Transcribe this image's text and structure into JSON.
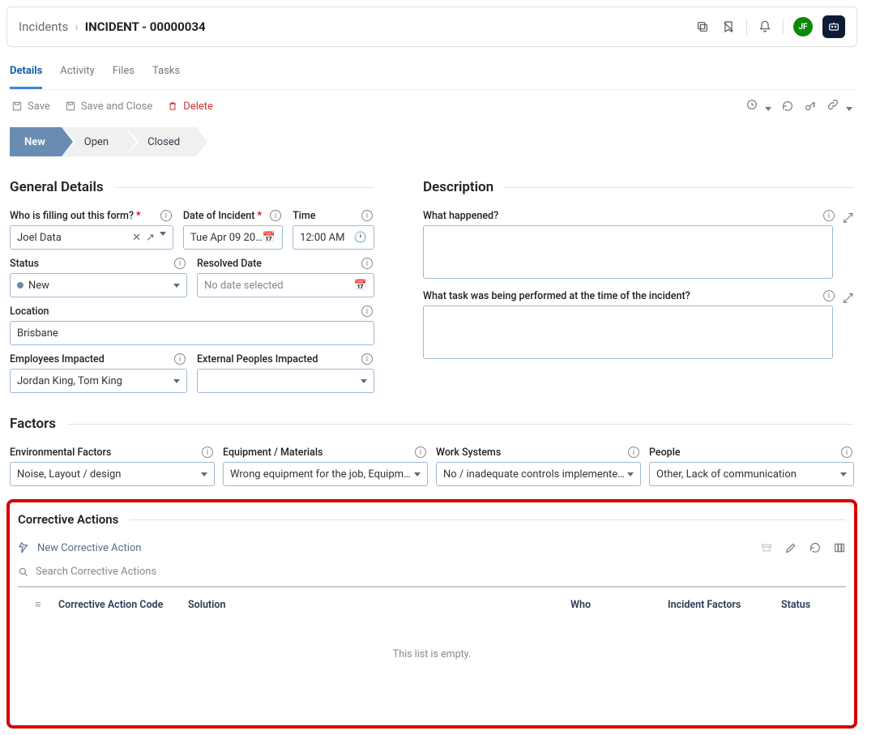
{
  "breadcrumb": {
    "root": "Incidents",
    "title": "INCIDENT - 00000034"
  },
  "header": {
    "avatar": "JF"
  },
  "tabs": [
    {
      "label": "Details",
      "active": true
    },
    {
      "label": "Activity"
    },
    {
      "label": "Files"
    },
    {
      "label": "Tasks"
    }
  ],
  "toolbar": {
    "save": "Save",
    "save_close": "Save and Close",
    "delete": "Delete"
  },
  "stages": [
    {
      "label": "New",
      "active": true
    },
    {
      "label": "Open"
    },
    {
      "label": "Closed"
    }
  ],
  "sections": {
    "general": {
      "title": "General Details",
      "filler": {
        "label": "Who is filling out this form?",
        "required": true,
        "value": "Joel Data"
      },
      "date": {
        "label": "Date of Incident",
        "required": true,
        "value": "Tue Apr 09 20…"
      },
      "time": {
        "label": "Time",
        "value": "12:00 AM"
      },
      "status": {
        "label": "Status",
        "value": "New"
      },
      "resolved": {
        "label": "Resolved Date",
        "placeholder": "No date selected"
      },
      "location": {
        "label": "Location",
        "value": "Brisbane"
      },
      "emp_impacted": {
        "label": "Employees Impacted",
        "value": "Jordan King, Tom King"
      },
      "ext_impacted": {
        "label": "External Peoples Impacted",
        "value": ""
      }
    },
    "description": {
      "title": "Description",
      "what": {
        "label": "What happened?"
      },
      "task": {
        "label": "What task was being performed at the time of the incident?"
      }
    },
    "factors": {
      "title": "Factors",
      "env": {
        "label": "Environmental Factors",
        "value": "Noise, Layout / design"
      },
      "equip": {
        "label": "Equipment / Materials",
        "value": "Wrong equipment for the job, Equipm…"
      },
      "work": {
        "label": "Work Systems",
        "value": "No / inadequate controls implemente…"
      },
      "people": {
        "label": "People",
        "value": "Other, Lack of communication"
      }
    },
    "corrective": {
      "title": "Corrective Actions",
      "new_btn": "New Corrective Action",
      "search_placeholder": "Search Corrective Actions",
      "columns": {
        "code": "Corrective Action Code",
        "solution": "Solution",
        "who": "Who",
        "factors": "Incident Factors",
        "status": "Status"
      },
      "empty": "This list is empty."
    }
  }
}
